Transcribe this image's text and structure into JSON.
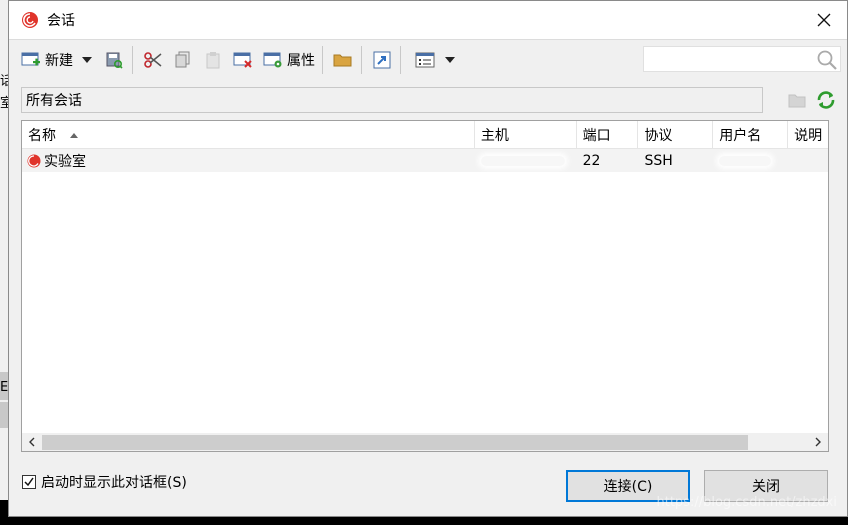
{
  "background": {
    "fragments": [
      "话",
      "室",
      "E"
    ]
  },
  "dialog": {
    "title": "会话",
    "toolbar": {
      "new_label": "新建",
      "properties_label": "属性"
    },
    "search": {
      "placeholder": ""
    },
    "folder": {
      "name": "所有会话"
    },
    "table": {
      "columns": [
        "名称",
        "主机",
        "端口",
        "协议",
        "用户名",
        "说明"
      ],
      "rows": [
        {
          "name": "实验室",
          "host": "",
          "port": "22",
          "protocol": "SSH",
          "user": "",
          "desc": ""
        }
      ]
    },
    "startup_checkbox": {
      "label": "启动时显示此对话框(S)",
      "checked": true
    },
    "connect_label": "连接(C)",
    "close_label": "关闭"
  },
  "watermark": "https://blog.csdn.net/zhzdxi"
}
